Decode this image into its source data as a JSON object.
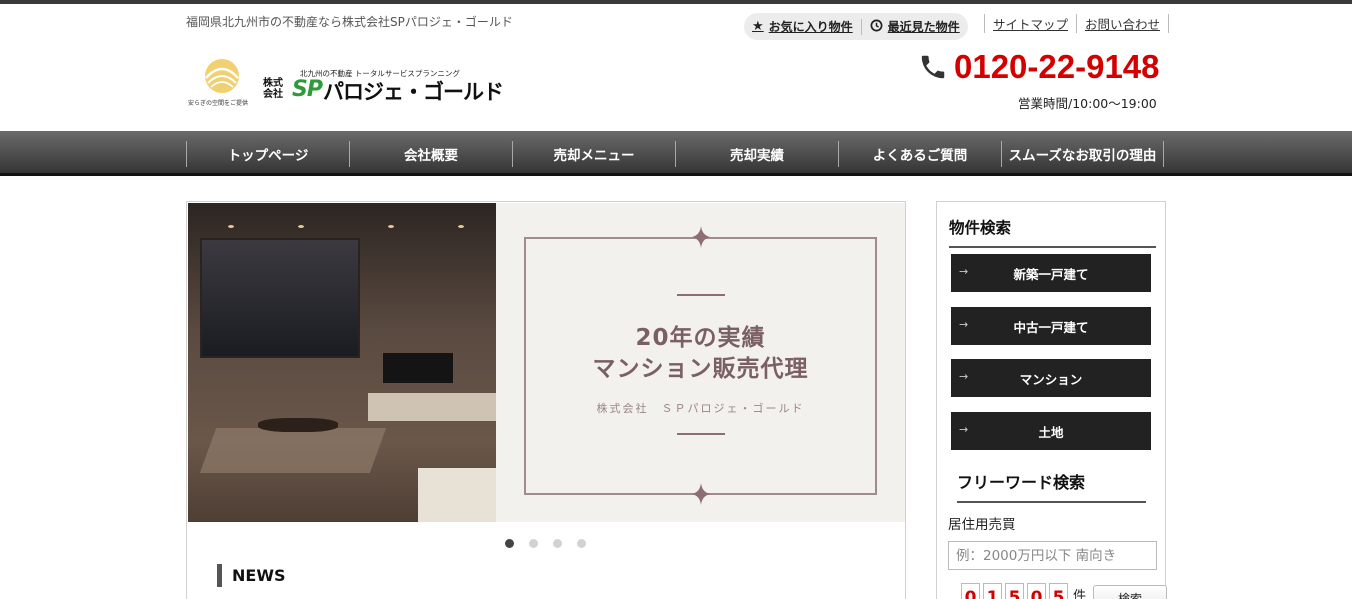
{
  "header": {
    "tagline": "福岡県北九州市の不動産なら株式会社SPパロジェ・ゴールド",
    "util": {
      "favorites_label": "お気に入り物件",
      "recent_label": "最近見た物件"
    },
    "links": [
      "サイトマップ",
      "お問い合わせ"
    ],
    "logo": {
      "tiny_text": "安らぎの空間をご提供",
      "kaisha": "株式会社",
      "sub": "北九州の不動産 トータルサービスプランニング",
      "sp": "SP",
      "name": "パロジェ・ゴールド"
    },
    "phone": "0120-22-9148",
    "hours": "営業時間/10:00～19:00"
  },
  "nav": [
    "トップページ",
    "会社概要",
    "売却メニュー",
    "売却実績",
    "よくあるご質問",
    "スムーズなお取引の理由"
  ],
  "slider": {
    "line1": "20年の実績",
    "line2": "マンション販売代理",
    "company": "株式会社　ＳＰパロジェ・ゴールド",
    "active_index": 0,
    "dot_count": 4
  },
  "news": {
    "heading": "NEWS"
  },
  "sidebar": {
    "property_search_title": "物件検索",
    "buttons": [
      "新築一戸建て",
      "中古一戸建て",
      "マンション",
      "土地"
    ],
    "freeword_title": "フリーワード検索",
    "category_label": "居住用売買",
    "input_placeholder": "例：2000万円以下 南向き",
    "count_digits": [
      "0",
      "1",
      "5",
      "0",
      "5"
    ],
    "count_unit": "件",
    "search_button": "検索"
  },
  "colors": {
    "phone_red": "#d40000",
    "nav_dark": "#353535",
    "accent_green": "#2f9a3a"
  }
}
